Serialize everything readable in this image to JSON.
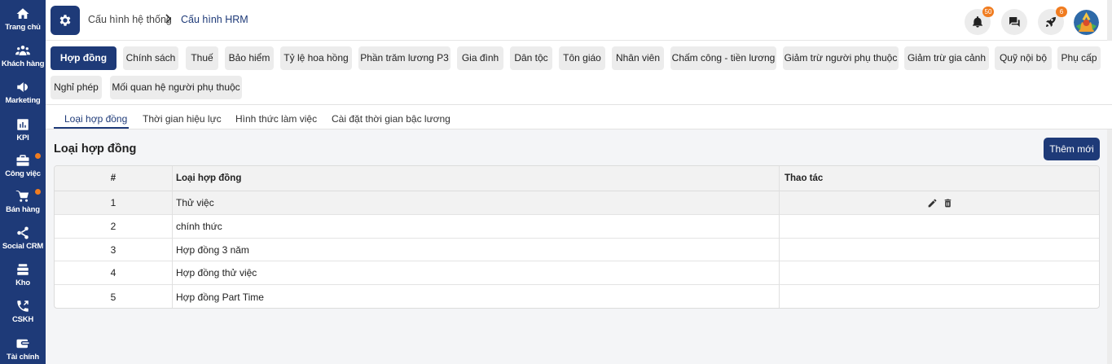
{
  "sidebar": {
    "items": [
      {
        "label": "Trang chủ",
        "icon": "home-icon"
      },
      {
        "label": "Khách hàng",
        "icon": "customers-icon"
      },
      {
        "label": "Marketing",
        "icon": "megaphone-icon"
      },
      {
        "label": "KPI",
        "icon": "chart-icon"
      },
      {
        "label": "Công việc",
        "icon": "briefcase-icon"
      },
      {
        "label": "Bán hàng",
        "icon": "cart-icon"
      },
      {
        "label": "Social CRM",
        "icon": "share-icon"
      },
      {
        "label": "Kho",
        "icon": "warehouse-icon"
      },
      {
        "label": "CSKH",
        "icon": "phone-icon"
      },
      {
        "label": "Tài chính",
        "icon": "wallet-icon"
      }
    ]
  },
  "header": {
    "breadcrumb_root": "Cấu hình hệ thống",
    "breadcrumb_current": "Cấu hình HRM",
    "notification_count": "50",
    "rocket_count": "6"
  },
  "pills": [
    "Hợp đồng",
    "Chính sách",
    "Thuế",
    "Bảo hiểm",
    "Tỷ lệ hoa hồng",
    "Phần trăm lương P3",
    "Gia đình",
    "Dân tộc",
    "Tôn giáo",
    "Nhân viên",
    "Chấm công - tiền lương",
    "Giảm trừ người phụ thuộc",
    "Giảm trừ gia cảnh",
    "Quỹ nội bộ",
    "Phụ cấp",
    "Nghỉ phép",
    "Mối quan hệ người phụ thuộc"
  ],
  "subtabs": [
    "Loại hợp đồng",
    "Thời gian hiệu lực",
    "Hình thức làm việc",
    "Cài đặt thời gian bậc lương"
  ],
  "section": {
    "title": "Loại hợp đồng",
    "add_label": "Thêm mới"
  },
  "table": {
    "columns": [
      "#",
      "Loại hợp đồng",
      "Thao tác"
    ],
    "rows": [
      {
        "num": "1",
        "name": "Thử việc"
      },
      {
        "num": "2",
        "name": "chính thức"
      },
      {
        "num": "3",
        "name": "Hợp đồng 3 năm"
      },
      {
        "num": "4",
        "name": "Hợp đồng thử việc"
      },
      {
        "num": "5",
        "name": "Hợp đồng Part Time"
      }
    ]
  },
  "colors": {
    "primary": "#1e3a78",
    "badge": "#f07c20",
    "pill_bg": "#ececec"
  }
}
